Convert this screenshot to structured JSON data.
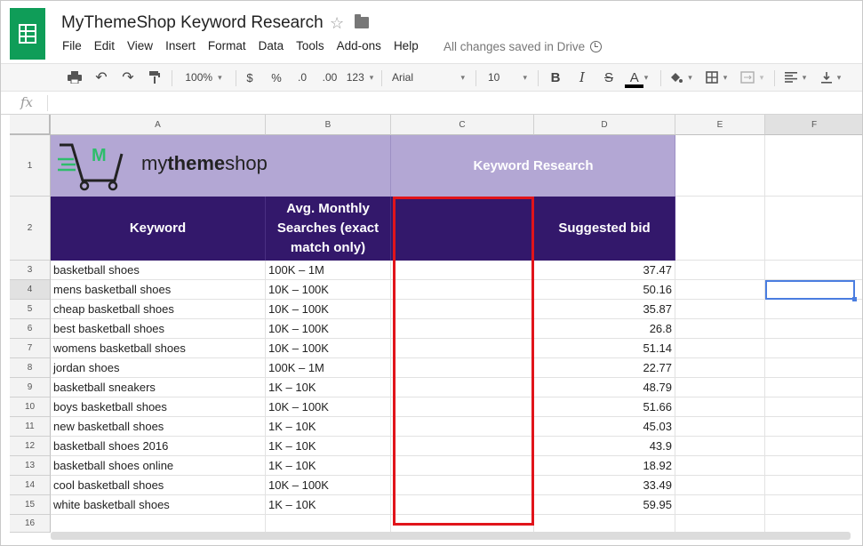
{
  "app": {
    "title": "MyThemeShop Keyword Research",
    "save_status": "All changes saved in Drive",
    "menu": [
      "File",
      "Edit",
      "View",
      "Insert",
      "Format",
      "Data",
      "Tools",
      "Add-ons",
      "Help"
    ]
  },
  "toolbar": {
    "zoom": "100%",
    "currency": "$",
    "percent": "%",
    "decrease_decimals": ".0",
    "increase_decimals": ".00",
    "more_formats": "123",
    "font": "Arial",
    "font_size": "10",
    "bold": "B",
    "italic": "I",
    "strike": "S",
    "text_color": "A"
  },
  "formula_bar": {
    "fx_label": "fx",
    "value": ""
  },
  "columns": [
    "A",
    "B",
    "C",
    "D",
    "E",
    "F"
  ],
  "rows": [
    "1",
    "2",
    "3",
    "4",
    "5",
    "6",
    "7",
    "8",
    "9",
    "10",
    "11",
    "12",
    "13",
    "14",
    "15",
    "16"
  ],
  "banner": {
    "brand_light": "my",
    "brand_bold": "theme",
    "brand_light2": "shop",
    "logo_letter": "M",
    "heading": "Keyword Research"
  },
  "headers": {
    "keyword": "Keyword",
    "searches": "Avg. Monthly Searches (exact match only)",
    "blank": "",
    "bid": "Suggested bid"
  },
  "table": [
    {
      "keyword": "basketball shoes",
      "searches": "100K – 1M",
      "bid": "37.47"
    },
    {
      "keyword": "mens basketball shoes",
      "searches": "10K – 100K",
      "bid": "50.16"
    },
    {
      "keyword": "cheap basketball shoes",
      "searches": "10K – 100K",
      "bid": "35.87"
    },
    {
      "keyword": "best basketball shoes",
      "searches": "10K – 100K",
      "bid": "26.8"
    },
    {
      "keyword": "womens basketball shoes",
      "searches": "10K – 100K",
      "bid": "51.14"
    },
    {
      "keyword": "jordan shoes",
      "searches": "100K – 1M",
      "bid": "22.77"
    },
    {
      "keyword": "basketball sneakers",
      "searches": "1K – 10K",
      "bid": "48.79"
    },
    {
      "keyword": "boys basketball shoes",
      "searches": "10K – 100K",
      "bid": "51.66"
    },
    {
      "keyword": "new basketball shoes",
      "searches": "1K – 10K",
      "bid": "45.03"
    },
    {
      "keyword": "basketball shoes 2016",
      "searches": "1K – 10K",
      "bid": "43.9"
    },
    {
      "keyword": "basketball shoes online",
      "searches": "1K – 10K",
      "bid": "18.92"
    },
    {
      "keyword": "cool basketball shoes",
      "searches": "10K – 100K",
      "bid": "33.49"
    },
    {
      "keyword": "white basketball shoes",
      "searches": "1K – 10K",
      "bid": "59.95"
    }
  ],
  "colors": {
    "header_bg": "#33186b",
    "banner_bg": "#b3a7d4",
    "highlight": "#e1141b",
    "sheets_green": "#0f9d58"
  }
}
